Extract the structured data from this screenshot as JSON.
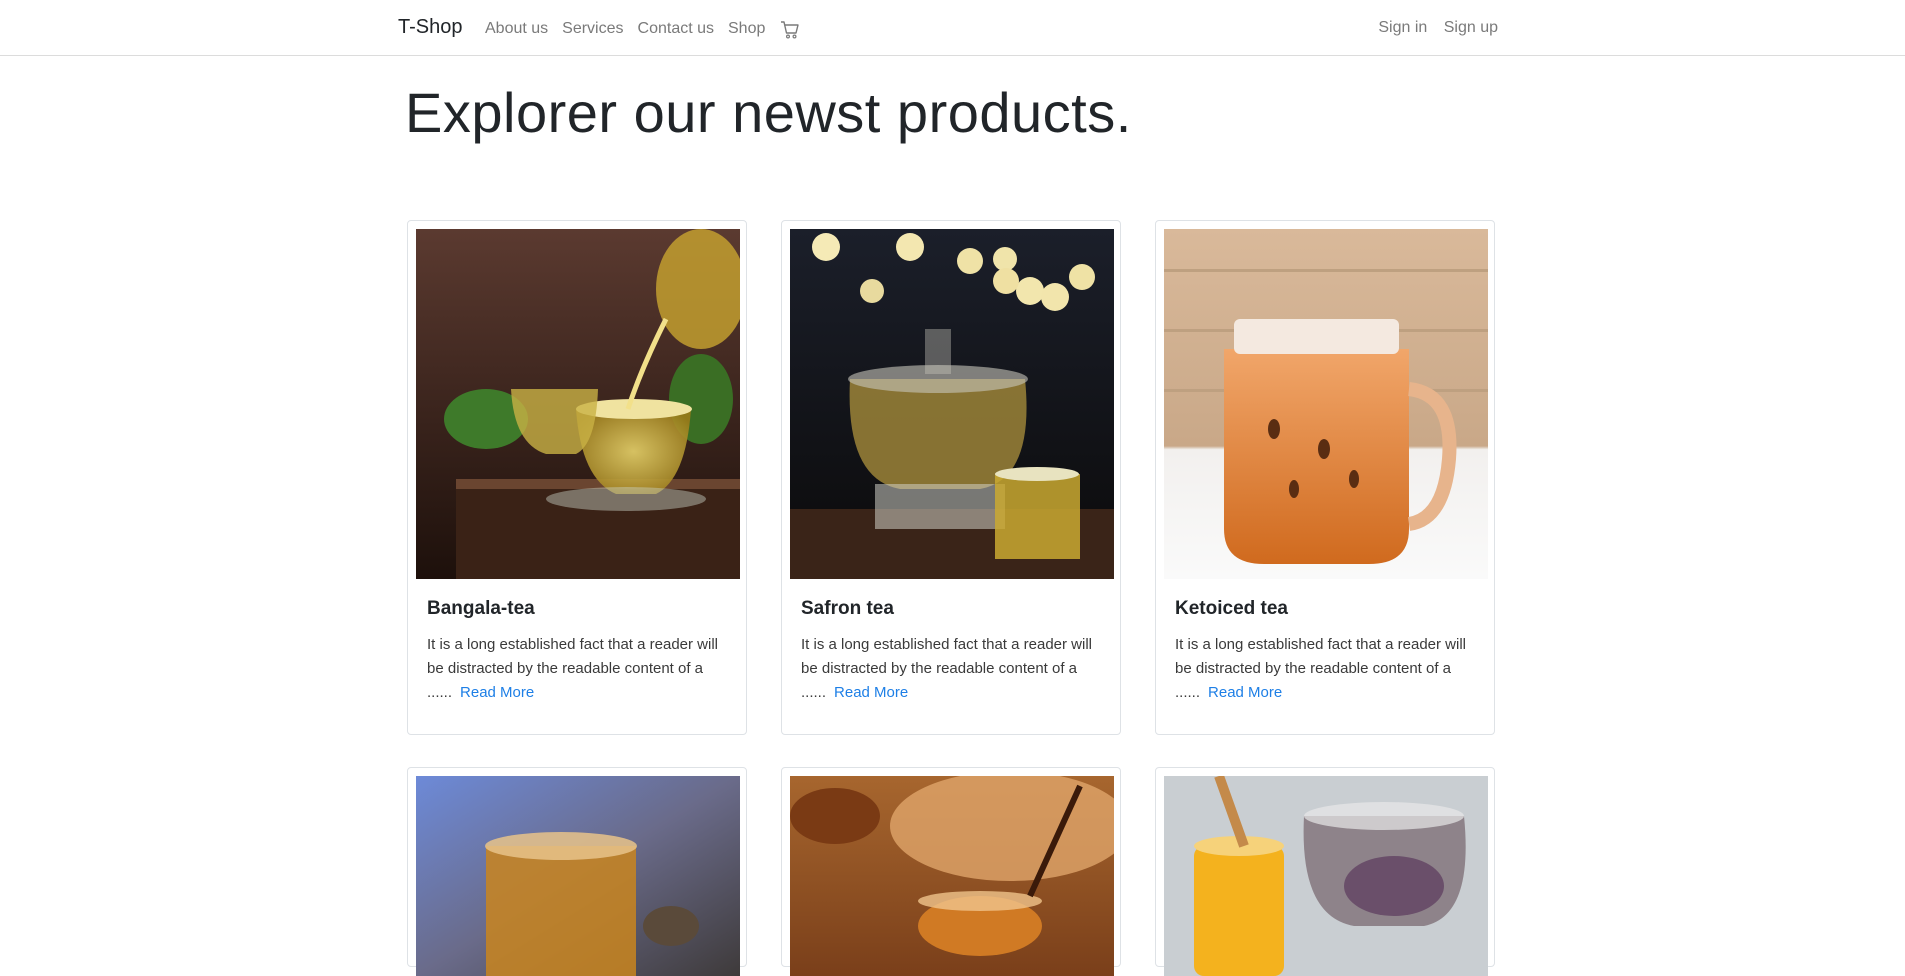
{
  "navbar": {
    "brand": "T-Shop",
    "links": [
      "About us",
      "Services",
      "Contact us",
      "Shop"
    ],
    "cart_icon": "cart-icon",
    "auth": [
      "Sign in",
      "Sign up"
    ]
  },
  "hero": {
    "title": "Explorer our newst products."
  },
  "products": [
    {
      "name": "Bangala-tea",
      "description": "It is a long established fact that a reader will be distracted by the readable content of a ......",
      "link": "Read More"
    },
    {
      "name": "Safron tea",
      "description": "It is a long established fact that a reader will be distracted by the readable content of a ......",
      "link": "Read More"
    },
    {
      "name": "Ketoiced tea",
      "description": "It is a long established fact that a reader will be distracted by the readable content of a ......",
      "link": "Read More"
    }
  ],
  "colors": {
    "link": "#1e7fe6",
    "muted": "#7a7a7a",
    "text": "#212529"
  }
}
